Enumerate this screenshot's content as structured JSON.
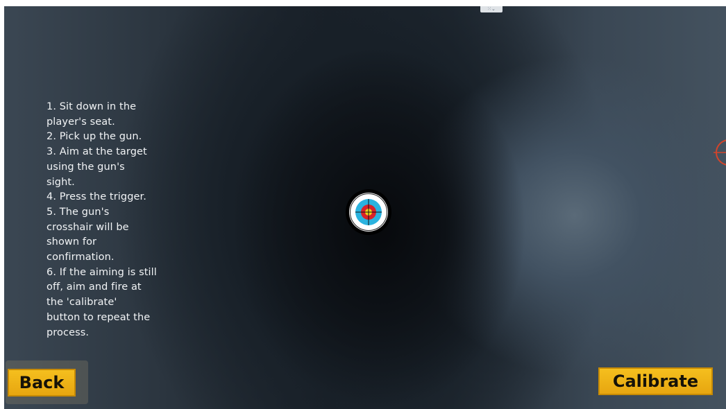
{
  "window": {
    "top_handle_glyph": "⁙⌄"
  },
  "instructions": {
    "lines": [
      "1. Sit down in the",
      "player's seat.",
      "2. Pick up the gun.",
      "3. Aim at the target",
      "using the gun's",
      "sight.",
      "4. Press the trigger.",
      "5. The gun's",
      "crosshair will be",
      "shown for",
      "confirmation.",
      "6. If the aiming is still",
      "off, aim and fire at",
      "the 'calibrate'",
      "button to repeat the",
      "process."
    ]
  },
  "target": {
    "icon": "bullseye-target-icon",
    "ring_colors": [
      "#000000",
      "#ffffff",
      "#2bb3df",
      "#d8232a",
      "#f1d21a"
    ]
  },
  "edge_marker": {
    "icon": "crosshair-icon",
    "color": "#d4442a"
  },
  "buttons": {
    "back_label": "Back",
    "calibrate_label": "Calibrate"
  },
  "colors": {
    "button_fill": "#f0b419",
    "button_text": "#161208",
    "instruction_text": "#f2f4f6"
  }
}
